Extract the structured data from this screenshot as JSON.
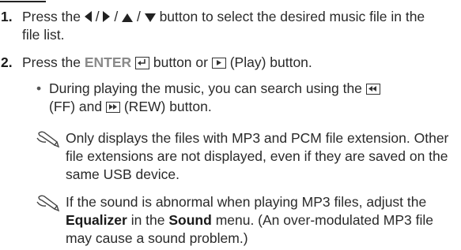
{
  "steps": [
    {
      "number": "1.",
      "pre": "Press the",
      "nav_sep": "/",
      "post": "button to select the desired music file in the file list.",
      "icons": [
        "left-arrow-icon",
        "right-arrow-icon",
        "up-arrow-icon",
        "down-arrow-icon"
      ]
    },
    {
      "number": "2.",
      "pre": "Press the",
      "enter_label": "ENTER",
      "or_text": "button or",
      "play_label": "(Play) button.",
      "icons": [
        "enter-icon",
        "play-icon"
      ]
    }
  ],
  "bullet": {
    "text_a": "During playing the music, you can search using the",
    "ff_label": "(FF) and",
    "rew_label": "(REW) button.",
    "icons": [
      "rewind-icon",
      "fast-forward-icon"
    ]
  },
  "notes": [
    {
      "icon": "note-pencil-icon",
      "text": "Only displays the files with MP3 and PCM file extension. Other file extensions are not displayed, even if they are saved on the same USB device."
    },
    {
      "icon": "note-pencil-icon",
      "pre": "If the sound is abnormal when playing MP3 files, adjust the",
      "equalizer": "Equalizer",
      "in_the": "in the",
      "sound": "Sound",
      "post": "menu. (An over-modulated MP3 file may cause a sound problem.)"
    }
  ],
  "colors": {
    "text": "#2a2a2a",
    "enter": "#8a8a8a",
    "rule": "#222222"
  }
}
